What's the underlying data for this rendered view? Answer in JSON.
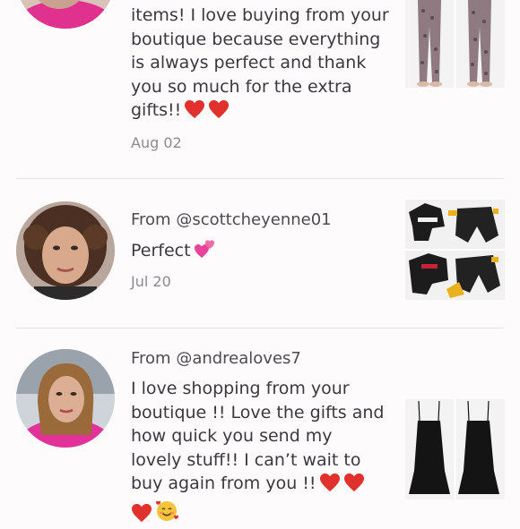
{
  "reviews": [
    {
      "from": "",
      "comment_lines": [
        "items! I love buying from your",
        "boutique because everything",
        "is always perfect and thank",
        "you so much for the extra",
        "gifts!!"
      ],
      "trailing_emojis": [
        "red-heart",
        "red-heart"
      ],
      "date": "Aug 02",
      "thumb_alt": "Leopard print leggings",
      "accent": "#d63a86"
    },
    {
      "from": "From @scottcheyenne01",
      "comment_lines": [
        "Perfect"
      ],
      "trailing_emojis": [
        "two-hearts"
      ],
      "date": "Jul 20",
      "thumb_alt": "Black tracksuit set",
      "accent": "#000000"
    },
    {
      "from": "From @andrealoves7",
      "comment_lines": [
        "I love shopping from your",
        "boutique !! Love the gifts and",
        "how quick you send my",
        "lovely stuff!! I can’t wait to",
        "buy again from you !!"
      ],
      "trailing_emojis": [
        "red-heart",
        "red-heart"
      ],
      "extra_line_emojis": [
        "red-heart",
        "smiling-face-with-hearts"
      ],
      "date": "",
      "thumb_alt": "Black spaghetti strap dress",
      "accent": "#e0318f"
    }
  ],
  "colors": {
    "background": "#fdfbfc",
    "text": "#3a3a3e",
    "muted": "#8a8a90",
    "divider": "#e7e4e6",
    "heart": "#e0312c"
  }
}
